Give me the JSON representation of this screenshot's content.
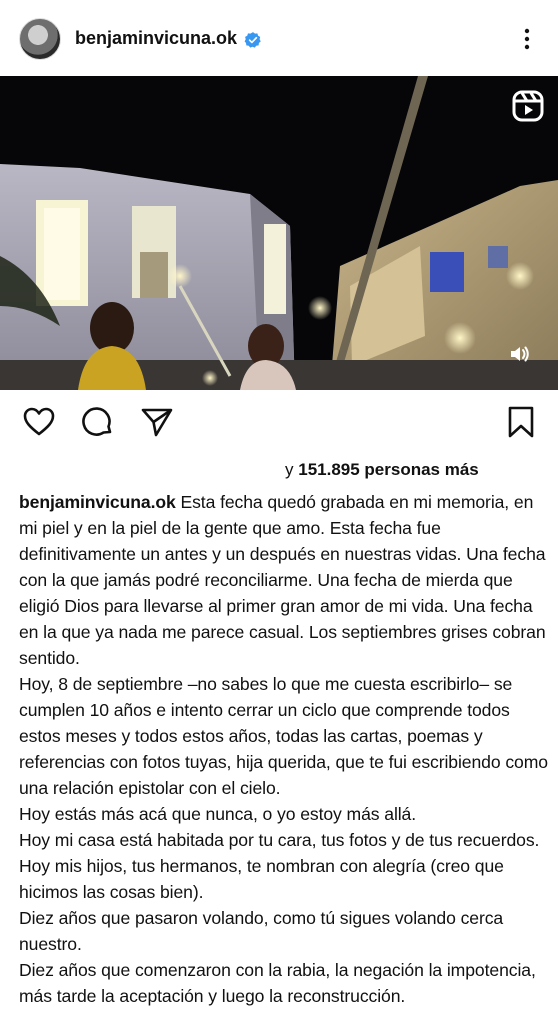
{
  "post": {
    "username": "benjaminvicuna.ok",
    "verified_icon": "verified-badge-icon",
    "more_icon": "more-vertical-icon"
  },
  "media": {
    "type_icon": "reels-icon",
    "sound_icon": "sound-on-icon"
  },
  "actions": {
    "like_icon": "heart-icon",
    "comment_icon": "comment-icon",
    "share_icon": "send-icon",
    "save_icon": "bookmark-icon"
  },
  "likes": {
    "prefix": "y ",
    "count": "151.895",
    "suffix": " personas más"
  },
  "caption": {
    "author": "benjaminvicuna.ok",
    "text": " Esta fecha quedó grabada en mi memoria, en mi piel y en la piel de la gente que amo. Esta fecha fue definitivamente un antes y un después en nuestras vidas. Una fecha con la que jamás podré reconciliarme. Una fecha de mierda que eligió Dios para llevarse al primer gran amor de mi vida. Una fecha en la que ya nada me parece casual. Los septiembres grises cobran sentido.\nHoy, 8 de septiembre –no sabes lo que me cuesta escribirlo– se cumplen 10 años e intento cerrar un ciclo que comprende todos estos meses y todos estos años, todas las cartas, poemas y referencias con fotos tuyas, hija querida, que te fui escribiendo como una relación epistolar con el cielo.\nHoy estás más acá que nunca, o yo estoy más allá.\nHoy mi casa está habitada por tu cara, tus fotos y de tus recuerdos.\nHoy mis hijos, tus hermanos, te nombran con alegría (creo que hicimos las cosas bien).\nDiez años que pasaron volando, como tú sigues volando cerca nuestro.\nDiez años que comenzaron con la rabia, la negación la impotencia, más tarde la aceptación y luego la reconstrucción."
  },
  "colors": {
    "verified": "#3897f0",
    "text": "#111111"
  }
}
